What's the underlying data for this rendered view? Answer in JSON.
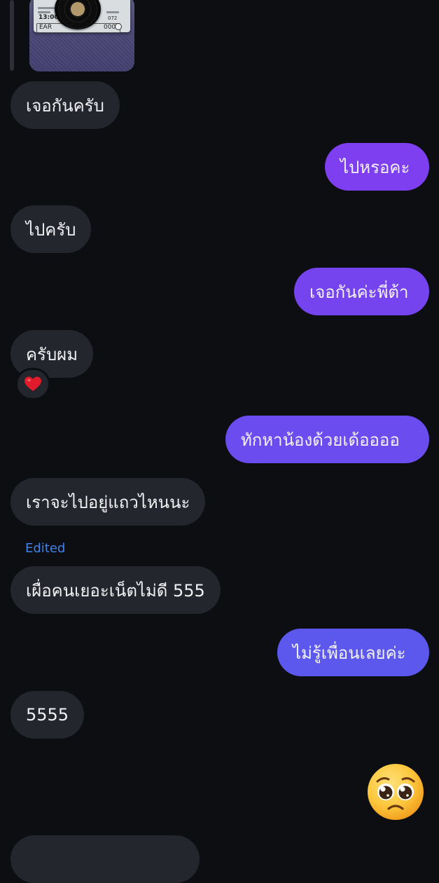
{
  "conversation": {
    "messages": [
      {
        "id": "m1",
        "side": "incoming",
        "text": "เจอกันครับ"
      },
      {
        "id": "m2",
        "side": "outgoing",
        "text": "ไปหรอคะ"
      },
      {
        "id": "m3",
        "side": "incoming",
        "text": "ไปครับ"
      },
      {
        "id": "m4",
        "side": "outgoing",
        "text": "เจอกันค่ะพี่ต้า"
      },
      {
        "id": "m5",
        "side": "incoming",
        "text": "ครับผม",
        "reaction": "❤️"
      },
      {
        "id": "m6",
        "side": "outgoing",
        "text": "ทักหาน้องด้วยเด้ออออ"
      },
      {
        "id": "m7",
        "side": "incoming",
        "text": "เราจะไปอยู่แถวไหนนะ"
      },
      {
        "id": "m8",
        "side": "incoming",
        "text": "เผื่อคนเยอะเน็ตไม่ดี 555",
        "edited_label": "Edited"
      },
      {
        "id": "m9",
        "side": "outgoing",
        "text": "ไม่รู้เพื่อนเลยค่ะ"
      },
      {
        "id": "m10",
        "side": "incoming",
        "text": "5555"
      },
      {
        "id": "m11",
        "side": "outgoing",
        "emoji": "pleading-face"
      }
    ]
  },
  "shared_image": {
    "ticket_time": "13:00",
    "ticket_label": "EAR",
    "ticket_amount": "000",
    "ticket_code": "072"
  },
  "colors": {
    "background": "#0c0e12",
    "incoming_bubble": "#23262c",
    "outgoing_gradient": [
      "#7e3ff0",
      "#7544ee",
      "#6b4cef",
      "#5c58ee"
    ],
    "edited_label": "#3f82e8",
    "text": "#f2f2f4"
  }
}
